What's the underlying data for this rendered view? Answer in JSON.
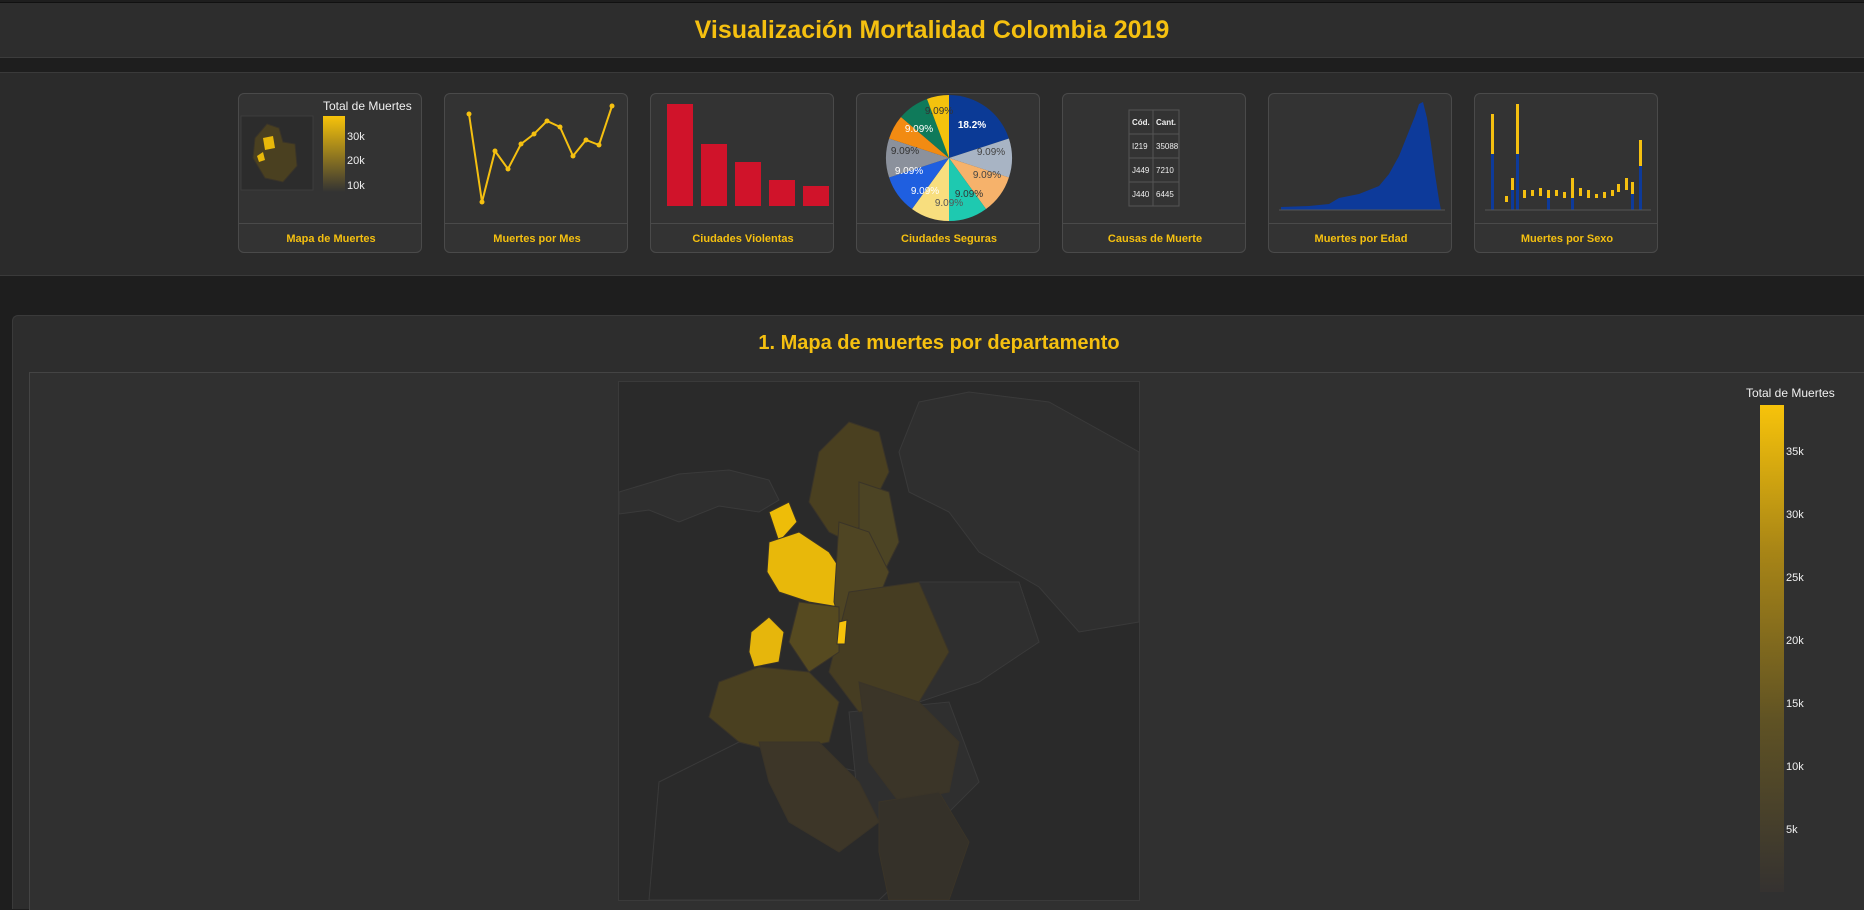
{
  "header": {
    "title": "Visualización Mortalidad Colombia 2019"
  },
  "nav": {
    "cards": [
      {
        "label": "Mapa de Muertes"
      },
      {
        "label": "Muertes por Mes"
      },
      {
        "label": "Ciudades Violentas"
      },
      {
        "label": "Ciudades Seguras"
      },
      {
        "label": "Causas de Muerte"
      },
      {
        "label": "Muertes por Edad"
      },
      {
        "label": "Muertes por Sexo"
      }
    ],
    "thumb_map": {
      "legend_title": "Total de Muertes",
      "ticks": [
        "30k",
        "20k",
        "10k"
      ]
    },
    "thumb_pie": {
      "labels": [
        "18.2%",
        "9.09%",
        "9.09%",
        "9.09%",
        "9.09%",
        "9.09%",
        "9.09%",
        "9.09%",
        "9.09%",
        "9.09%"
      ]
    },
    "thumb_table": {
      "headers": [
        "Cód.",
        "Cant."
      ],
      "rows": [
        [
          "I219",
          "35088"
        ],
        [
          "J449",
          "7210"
        ],
        [
          "J440",
          "6445"
        ]
      ]
    }
  },
  "section": {
    "title": "1. Mapa de muertes por departamento",
    "colorbar": {
      "title": "Total de Muertes",
      "ticks": [
        "35k",
        "30k",
        "25k",
        "20k",
        "15k",
        "10k",
        "5k"
      ]
    }
  },
  "colors": {
    "accent": "#f5c010",
    "bar_red": "#d0132a",
    "bar_blue": "#0d3a9a",
    "bg": "#1e1e1e"
  }
}
